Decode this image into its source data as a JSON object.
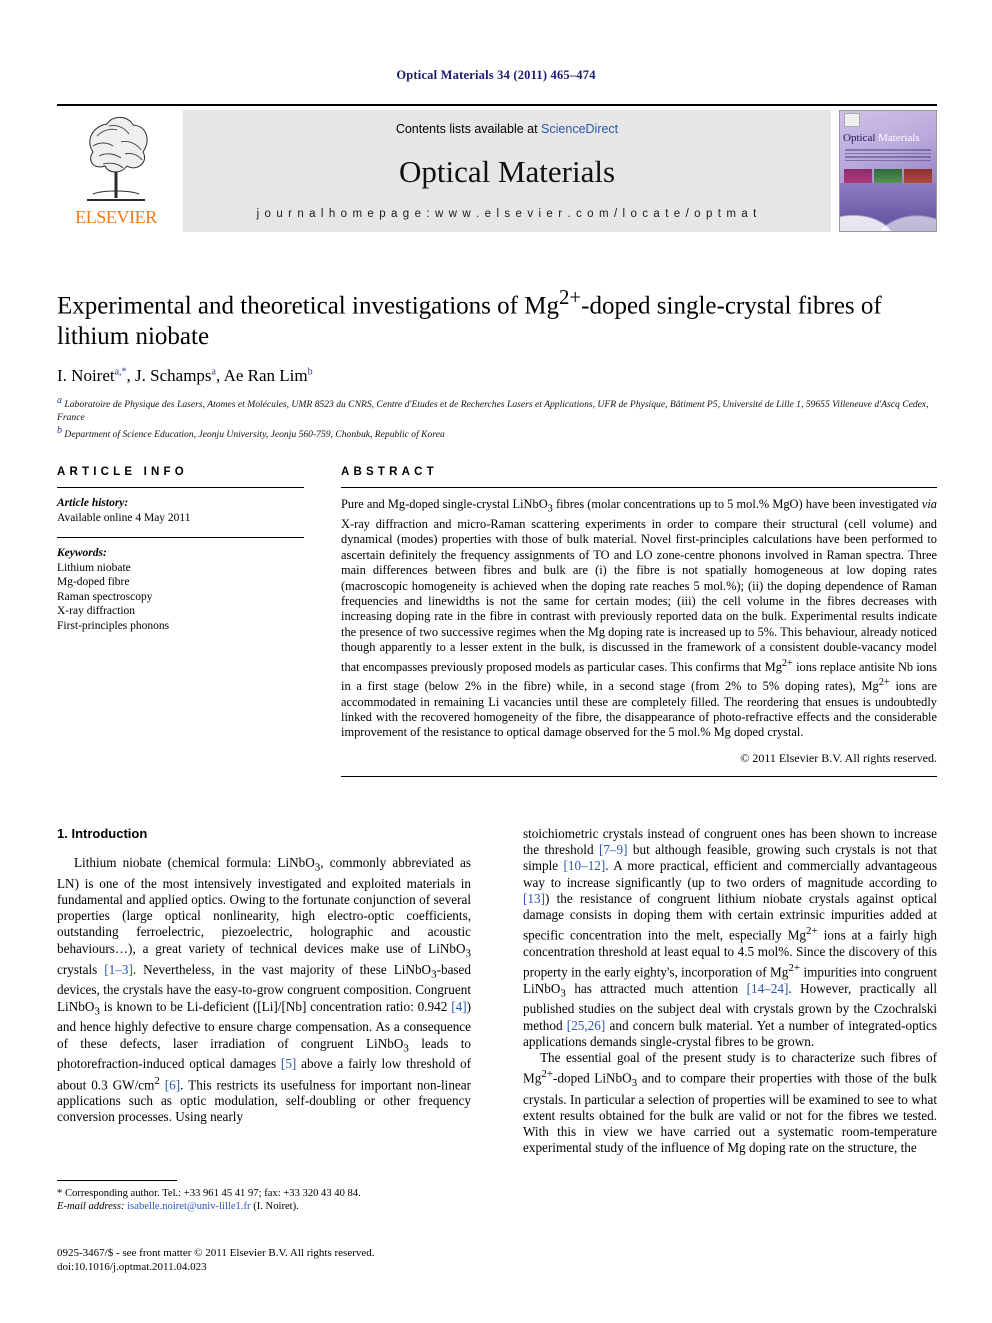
{
  "running_head": "Optical Materials 34 (2011) 465–474",
  "masthead": {
    "contents_prefix": "Contents lists available at ",
    "sciencedirect": "ScienceDirect",
    "journal_name": "Optical Materials",
    "homepage": "j o u r n a l   h o m e p a g e :   w w w . e l s e v i e r . c o m / l o c a t e / o p t m a t",
    "publisher": "ELSEVIER",
    "cover_title_1": "Optical",
    "cover_title_2": "Materials"
  },
  "title": "Experimental and theoretical investigations of Mg2+-doped single-crystal fibres of lithium niobate",
  "title_parts": {
    "before": "Experimental and theoretical investigations of Mg",
    "sup": "2+",
    "after": "-doped single-crystal fibres of lithium niobate"
  },
  "authors": [
    {
      "name": "I. Noiret",
      "marks": "a,*"
    },
    {
      "name": "J. Schamps",
      "marks": "a"
    },
    {
      "name": "Ae Ran Lim",
      "marks": "b"
    }
  ],
  "affiliations": [
    {
      "mark": "a",
      "text": "Laboratoire de Physique des Lasers, Atomes et Molécules, UMR 8523 du CNRS, Centre d'Etudes et de Recherches Lasers et Applications, UFR de Physique, Bâtiment P5, Université de Lille 1, 59655 Villeneuve d'Ascq Cedex, France"
    },
    {
      "mark": "b",
      "text": "Department of Science Education, Jeonju University, Jeonju 560-759, Chonbuk, Republic of Korea"
    }
  ],
  "article_info": {
    "label": "ARTICLE INFO",
    "history_head": "Article history:",
    "history_line": "Available online 4 May 2011",
    "keywords_head": "Keywords:",
    "keywords": [
      "Lithium niobate",
      "Mg-doped fibre",
      "Raman spectroscopy",
      "X-ray diffraction",
      "First-principles phonons"
    ]
  },
  "abstract": {
    "label": "ABSTRACT",
    "text": "Pure and Mg-doped single-crystal LiNbO3 fibres (molar concentrations up to 5 mol.% MgO) have been investigated via X-ray diffraction and micro-Raman scattering experiments in order to compare their structural (cell volume) and dynamical (modes) properties with those of bulk material. Novel first-principles calculations have been performed to ascertain definitely the frequency assignments of TO and LO zone-centre phonons involved in Raman spectra. Three main differences between fibres and bulk are (i) the fibre is not spatially homogeneous at low doping rates (macroscopic homogeneity is achieved when the doping rate reaches 5 mol.%); (ii) the doping dependence of Raman frequencies and linewidths is not the same for certain modes; (iii) the cell volume in the fibres decreases with increasing doping rate in the fibre in contrast with previously reported data on the bulk. Experimental results indicate the presence of two successive regimes when the Mg doping rate is increased up to 5%. This behaviour, already noticed though apparently to a lesser extent in the bulk, is discussed in the framework of a consistent double-vacancy model that encompasses previously proposed models as particular cases. This confirms that Mg2+ ions replace antisite Nb ions in a first stage (below 2% in the fibre) while, in a second stage (from 2% to 5% doping rates), Mg2+ ions are accommodated in remaining Li vacancies until these are completely filled. The reordering that ensues is undoubtedly linked with the recovered homogeneity of the fibre, the disappearance of photo-refractive effects and the considerable improvement of the resistance to optical damage observed for the 5 mol.% Mg doped crystal.",
    "copyright": "© 2011 Elsevier B.V. All rights reserved."
  },
  "introduction": {
    "heading": "1. Introduction",
    "left_paragraph_1": "Lithium niobate (chemical formula: LiNbO3, commonly abbreviated as LN) is one of the most intensively investigated and exploited materials in fundamental and applied optics. Owing to the fortunate conjunction of several properties (large optical nonlinearity, high electro-optic coefficients, outstanding ferroelectric, piezoelectric, holographic and acoustic behaviours…), a great variety of technical devices make use of LiNbO3 crystals [1–3]. Nevertheless, in the vast majority of these LiNbO3-based devices, the crystals have the easy-to-grow congruent composition. Congruent LiNbO3 is known to be Li-deficient ([Li]/[Nb] concentration ratio: 0.942 [4]) and hence highly defective to ensure charge compensation. As a consequence of these defects, laser irradiation of congruent LiNbO3 leads to photorefraction-induced optical damages [5] above a fairly low threshold of about 0.3 GW/cm2 [6]. This restricts its usefulness for important non-linear applications such as optic modulation, self-doubling or other frequency conversion processes. Using nearly",
    "right_paragraph_1": "stoichiometric crystals instead of congruent ones has been shown to increase the threshold [7–9] but although feasible, growing such crystals is not that simple [10–12]. A more practical, efficient and commercially advantageous way to increase significantly (up to two orders of magnitude according to [13]) the resistance of congruent lithium niobate crystals against optical damage consists in doping them with certain extrinsic impurities added at specific concentration into the melt, especially Mg2+ ions at a fairly high concentration threshold at least equal to 4.5 mol%. Since the discovery of this property in the early eighty's, incorporation of Mg2+ impurities into congruent LiNbO3 has attracted much attention [14–24]. However, practically all published studies on the subject deal with crystals grown by the Czochralski method [25,26] and concern bulk material. Yet a number of integrated-optics applications demands single-crystal fibres to be grown.",
    "right_paragraph_2": "The essential goal of the present study is to characterize such fibres of Mg2+-doped LiNbO3 and to compare their properties with those of the bulk crystals. In particular a selection of properties will be examined to see to what extent results obtained for the bulk are valid or not for the fibres we tested. With this in view we have carried out a systematic room-temperature experimental study of the influence of Mg doping rate on the structure, the"
  },
  "footnotes": {
    "corresponding": "* Corresponding author. Tel.: +33 961 45 41 97; fax: +33 320 43 40 84.",
    "email_label": "E-mail address:",
    "email": "isabelle.noiret@univ-lille1.fr",
    "email_suffix": "(I. Noiret)."
  },
  "imprint": {
    "issn_line": "0925-3467/$ - see front matter © 2011 Elsevier B.V. All rights reserved.",
    "doi_line": "doi:10.1016/j.optmat.2011.04.023"
  },
  "colors": {
    "link": "#2b56b0",
    "running_head": "#1a1a6e",
    "elsevier_orange": "#f07c1a",
    "band_gray": "#e6e6e6"
  }
}
